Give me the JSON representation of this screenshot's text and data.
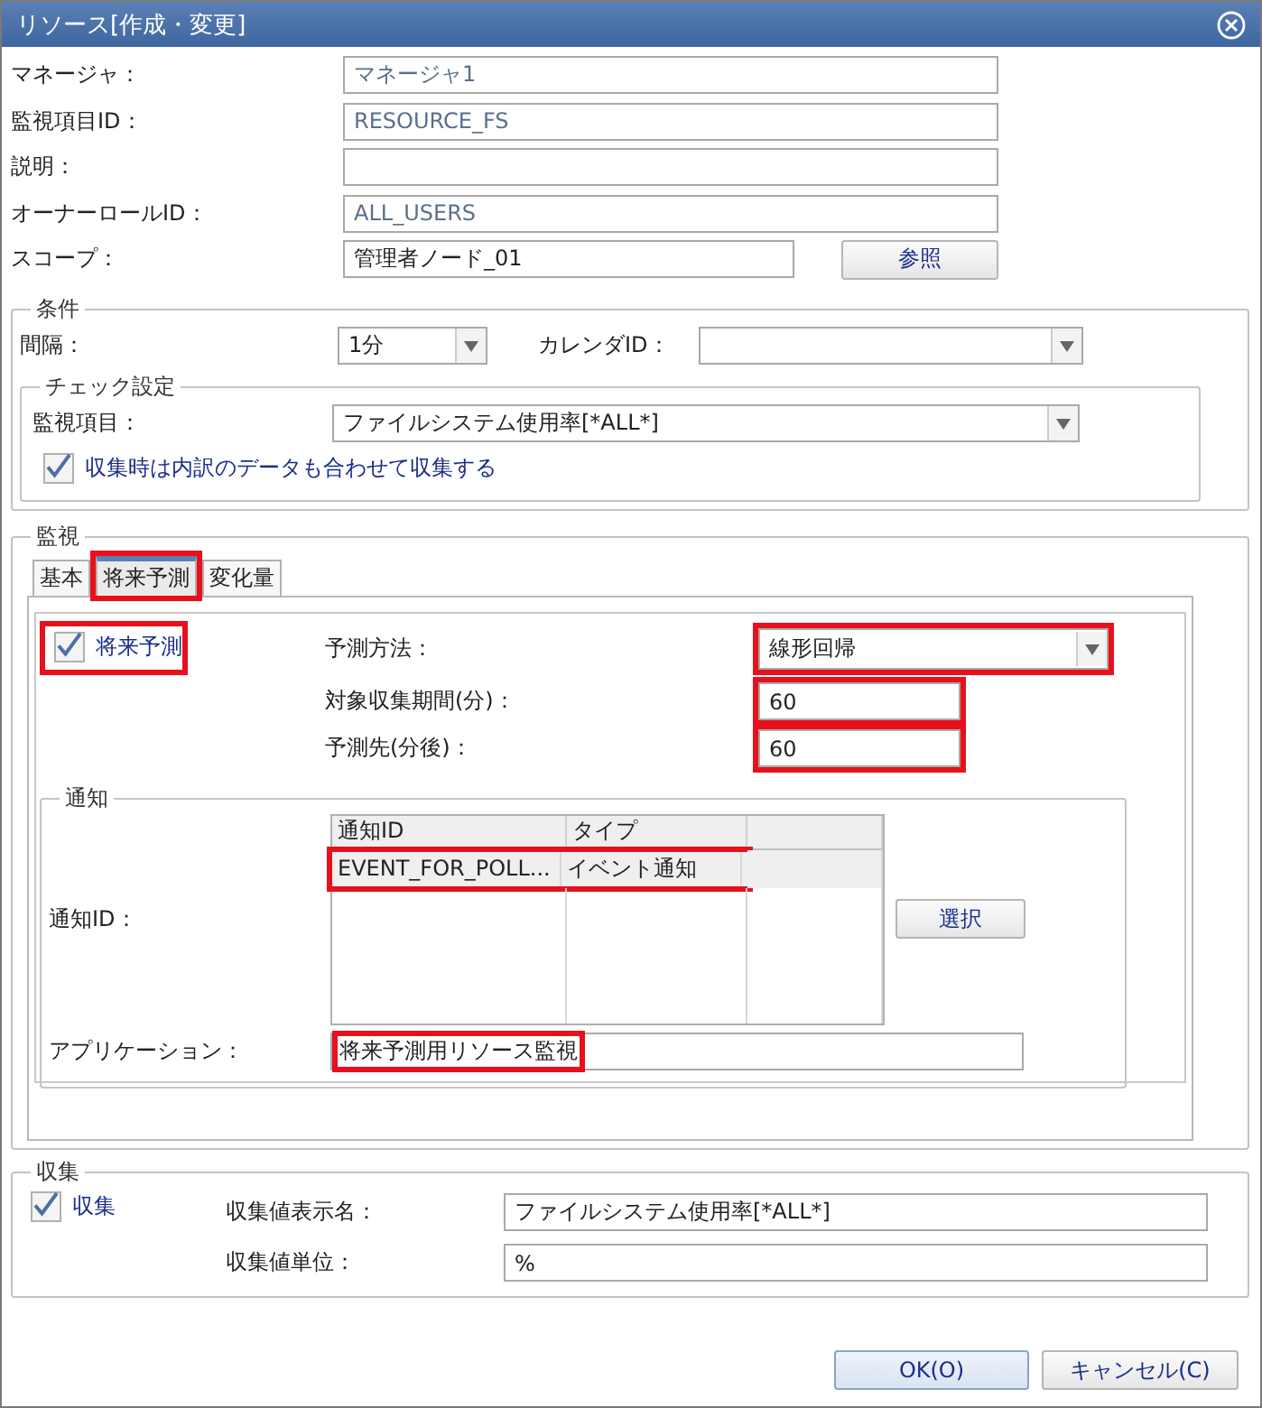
{
  "window": {
    "title": "リソース[作成・変更]"
  },
  "fields": [
    {
      "label": "マネージャ：",
      "value": "マネージャ1",
      "disabled": true
    },
    {
      "label": "監視項目ID：",
      "value": "RESOURCE_FS",
      "disabled": true
    },
    {
      "label": "説明："
    },
    {
      "label": "オーナーロールID：",
      "value": "ALL_USERS",
      "disabled": true
    }
  ],
  "scope": {
    "label": "スコープ：",
    "value": "管理者ノード_01",
    "button": "参照"
  },
  "conditions": {
    "legend": "条件",
    "interval": {
      "label": "間隔：",
      "value": "1分"
    },
    "calendar": {
      "label": "カレンダID："
    },
    "check": {
      "legend": "チェック設定",
      "item": {
        "label": "監視項目：",
        "value": "ファイルシステム使用率[*ALL*]"
      },
      "checkbox": {
        "label": "収集時は内訳のデータも合わせて収集する",
        "checked": true
      }
    }
  },
  "monitor": {
    "legend": "監視",
    "tabs": [
      {
        "label": "基本",
        "selected": false,
        "highlighted": false
      },
      {
        "label": "将来予測",
        "selected": true,
        "highlighted": true
      },
      {
        "label": "変化量",
        "selected": false,
        "highlighted": false
      }
    ],
    "prediction": {
      "checkbox": {
        "label": "将来予測",
        "checked": true,
        "highlighted": true
      },
      "fields": [
        {
          "kind": "select",
          "label": "予測方法：",
          "value": "線形回帰",
          "highlighted": true
        },
        {
          "kind": "text",
          "label": "対象収集期間(分)：",
          "value": "60",
          "highlighted": true
        },
        {
          "kind": "text",
          "label": "予測先(分後)：",
          "value": "60",
          "highlighted": true
        }
      ]
    },
    "notify": {
      "legend": "通知",
      "label": "通知ID：",
      "columns": [
        "通知ID",
        "タイプ"
      ],
      "rows": [
        {
          "cells": [
            "EVENT_FOR_POLL...",
            "イベント通知"
          ],
          "highlighted": true
        }
      ],
      "button": "選択",
      "application": {
        "label": "アプリケーション：",
        "value": "将来予測用リソース監視",
        "highlighted": true
      }
    }
  },
  "collect": {
    "legend": "収集",
    "checkbox": {
      "label": "収集",
      "checked": true
    },
    "fields": [
      {
        "label": "収集値表示名：",
        "value": "ファイルシステム使用率[*ALL*]"
      },
      {
        "label": "収集値単位：",
        "value": "%"
      }
    ]
  },
  "buttons": [
    {
      "label": "OK(O)",
      "kind": "primary"
    },
    {
      "label": "キャンセル(C)",
      "kind": "normal"
    }
  ]
}
